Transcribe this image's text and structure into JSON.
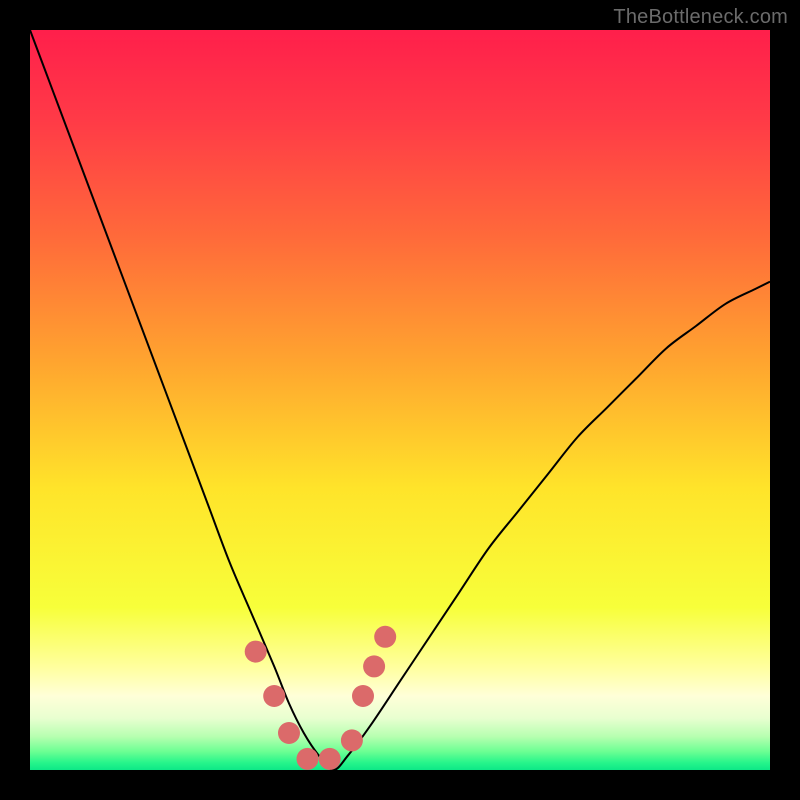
{
  "watermark": "TheBottleneck.com",
  "chart_data": {
    "type": "line",
    "title": "",
    "xlabel": "",
    "ylabel": "",
    "xlim": [
      0,
      100
    ],
    "ylim": [
      0,
      100
    ],
    "background_gradient": {
      "direction": "vertical",
      "stops": [
        {
          "offset": 0.0,
          "color": "#ff1f4b"
        },
        {
          "offset": 0.12,
          "color": "#ff3a47"
        },
        {
          "offset": 0.28,
          "color": "#ff6a3a"
        },
        {
          "offset": 0.45,
          "color": "#ffa52f"
        },
        {
          "offset": 0.62,
          "color": "#ffe42a"
        },
        {
          "offset": 0.78,
          "color": "#f7ff3a"
        },
        {
          "offset": 0.86,
          "color": "#ffff9d"
        },
        {
          "offset": 0.9,
          "color": "#ffffd8"
        },
        {
          "offset": 0.93,
          "color": "#e8ffd0"
        },
        {
          "offset": 0.955,
          "color": "#b6ffb0"
        },
        {
          "offset": 0.975,
          "color": "#6cff93"
        },
        {
          "offset": 0.99,
          "color": "#27f58b"
        },
        {
          "offset": 1.0,
          "color": "#0de887"
        }
      ]
    },
    "series": [
      {
        "name": "bottleneck-curve",
        "color": "#000000",
        "stroke_width": 2,
        "x": [
          0,
          3,
          6,
          9,
          12,
          15,
          18,
          21,
          24,
          27,
          30,
          33,
          35,
          37,
          39,
          41,
          43,
          46,
          50,
          54,
          58,
          62,
          66,
          70,
          74,
          78,
          82,
          86,
          90,
          94,
          98,
          100
        ],
        "values": [
          100,
          92,
          84,
          76,
          68,
          60,
          52,
          44,
          36,
          28,
          21,
          14,
          9,
          5,
          2,
          0,
          2,
          6,
          12,
          18,
          24,
          30,
          35,
          40,
          45,
          49,
          53,
          57,
          60,
          63,
          65,
          66
        ]
      },
      {
        "name": "highlight-markers",
        "type": "scatter",
        "color": "#db6a6a",
        "marker_radius": 11,
        "x": [
          30.5,
          33.0,
          35.0,
          37.5,
          40.5,
          43.5,
          45.0,
          46.5,
          48.0
        ],
        "values": [
          16.0,
          10.0,
          5.0,
          1.5,
          1.5,
          4.0,
          10.0,
          14.0,
          18.0
        ]
      }
    ]
  }
}
